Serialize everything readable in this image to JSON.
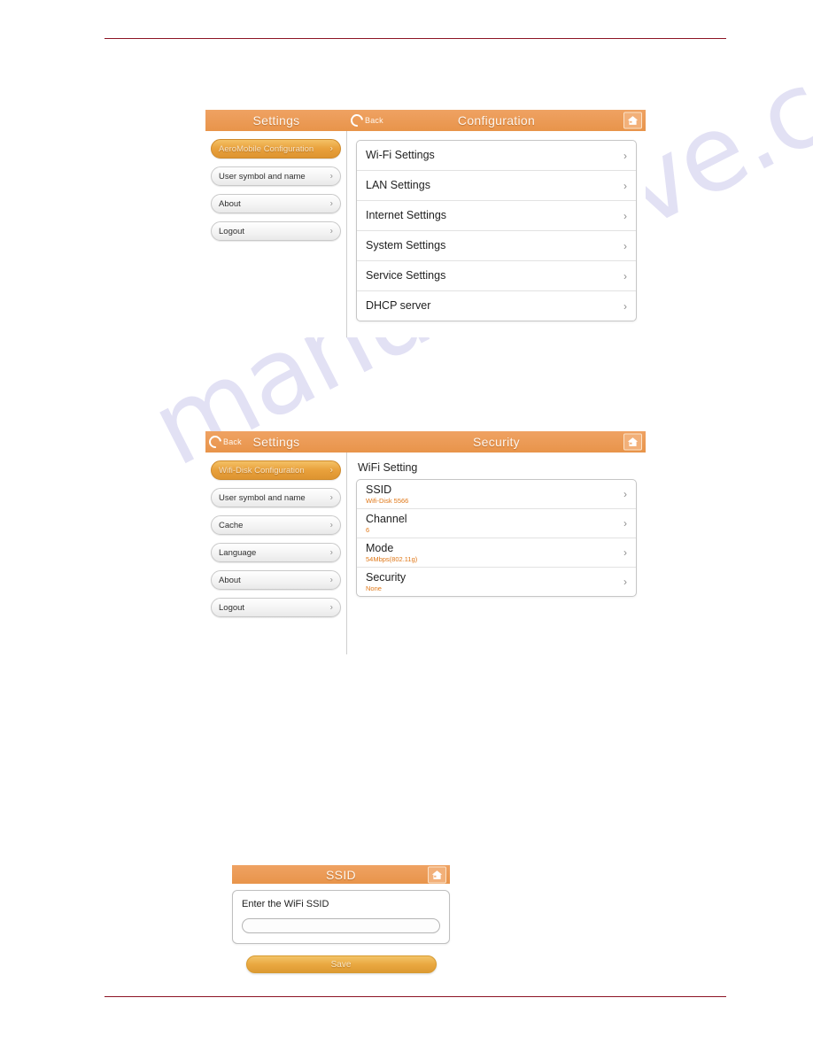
{
  "watermark": {
    "text": "manualshive.com"
  },
  "panel_config": {
    "header": {
      "left_title": "Settings",
      "right_title": "Configuration",
      "back_label": "Back",
      "home_icon": "home-icon",
      "back_icon": "back-circle-arrow-icon"
    },
    "sidebar": {
      "items": [
        {
          "label": "AeroMobile Configuration",
          "active": true
        },
        {
          "label": "User symbol and name",
          "active": false
        },
        {
          "label": "About",
          "active": false
        },
        {
          "label": "Logout",
          "active": false
        }
      ]
    },
    "list": {
      "items": [
        {
          "title": "Wi-Fi Settings"
        },
        {
          "title": "LAN Settings"
        },
        {
          "title": "Internet Settings"
        },
        {
          "title": "System Settings"
        },
        {
          "title": "Service Settings"
        },
        {
          "title": "DHCP server"
        }
      ]
    }
  },
  "panel_security": {
    "header": {
      "left_title": "Settings",
      "right_title": "Security",
      "back_label": "Back",
      "home_icon": "home-icon",
      "back_icon": "back-circle-arrow-icon"
    },
    "sidebar": {
      "items": [
        {
          "label": "Wifi-Disk Configuration",
          "active": true
        },
        {
          "label": "User symbol and name",
          "active": false
        },
        {
          "label": "Cache",
          "active": false
        },
        {
          "label": "Language",
          "active": false
        },
        {
          "label": "About",
          "active": false
        },
        {
          "label": "Logout",
          "active": false
        }
      ]
    },
    "content_title": "WiFi Setting",
    "list": {
      "items": [
        {
          "title": "SSID",
          "value": "Wifi-Disk 5566"
        },
        {
          "title": "Channel",
          "value": "6"
        },
        {
          "title": "Mode",
          "value": "54Mbps(802.11g)"
        },
        {
          "title": "Security",
          "value": "None"
        }
      ]
    }
  },
  "panel_ssid": {
    "header": {
      "title": "SSID",
      "home_icon": "home-icon"
    },
    "form": {
      "label": "Enter the WiFi SSID",
      "input_value": "",
      "input_placeholder": "",
      "save_label": "Save"
    }
  },
  "colors": {
    "header_orange": "#EB9A55",
    "accent_orange": "#E07818",
    "rule_red": "#8C1424",
    "watermark_purple": "#B9B6E6"
  }
}
